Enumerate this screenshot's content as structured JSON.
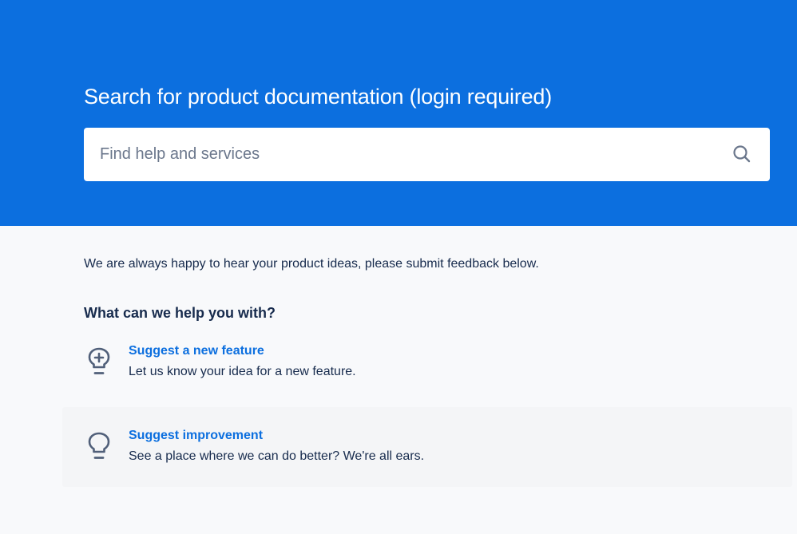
{
  "hero": {
    "title": "Search for product documentation (login required)",
    "search": {
      "placeholder": "Find help and services",
      "value": "",
      "icon": "search-icon"
    },
    "background_color": "#0c6fdf"
  },
  "main": {
    "intro": "We are always happy to hear your product ideas, please submit feedback below.",
    "heading": "What can we help you with?",
    "options": [
      {
        "icon": "lightbulb-plus-icon",
        "title": "Suggest a new feature",
        "description": "Let us know your idea for a new feature."
      },
      {
        "icon": "lightbulb-icon",
        "title": "Suggest improvement",
        "description": "See a place where we can do better? We're all ears."
      }
    ]
  },
  "colors": {
    "accent": "#0c6fdf",
    "text": "#172b4d",
    "muted": "#6b778c",
    "page_bg": "#f8f9fb",
    "hover_bg": "#f4f5f7"
  }
}
